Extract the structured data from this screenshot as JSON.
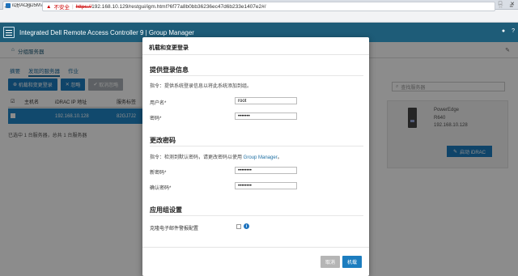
{
  "browser": {
    "tab_title": "iDRAC-8J5M7J2 - iDRA",
    "url_warning": "不安全",
    "url_scheme": "https://",
    "url_rest": "192.168.10.129/restgui/igm.html?6f77a8b0bb36236ec47d6b233e1407e2#/"
  },
  "app": {
    "title": "Integrated Dell Remote Access Controller 9 | Group Manager",
    "breadcrumb": "分组服务器",
    "tabs": [
      "摘要",
      "发现的服务器",
      "作业"
    ],
    "toolbar": [
      "机载和变更登录",
      "忽略",
      "取消忽略"
    ],
    "table_headers": [
      "主机名",
      "iDRAC IP 地址",
      "服务标签"
    ],
    "row": {
      "ip": "192.168.10.128",
      "tag": "82GJ7J2"
    },
    "summary": "已选中 1 台服务器，总共 1 台服务器",
    "search_placeholder": "查找服务器",
    "server": {
      "model": "PowerEdge",
      "model2": "R640",
      "ip": "192.168.10.128"
    },
    "launch_button": "启动 iDRAC"
  },
  "modal": {
    "title": "机载和变更登录",
    "login_section": "提供登录信息",
    "login_hint": "指令：提供系统登录信息以将此系统添加到组。",
    "username_label": "用户名*",
    "username_value": "root",
    "password_label": "密码*",
    "password_value": "•••••••",
    "change_section": "更改密码",
    "change_hint_pre": "指令：检测到默认密码，请更改密码以使用 ",
    "change_hint_link": "Group Manager",
    "change_hint_post": "。",
    "new_password_label": "新密码*",
    "new_password_value": "••••••••",
    "confirm_label": "确认密码*",
    "confirm_value": "••••••••",
    "group_section": "应用组设置",
    "email_label": "克隆电子邮件警报配置",
    "cancel": "取消",
    "ok": "机载"
  }
}
